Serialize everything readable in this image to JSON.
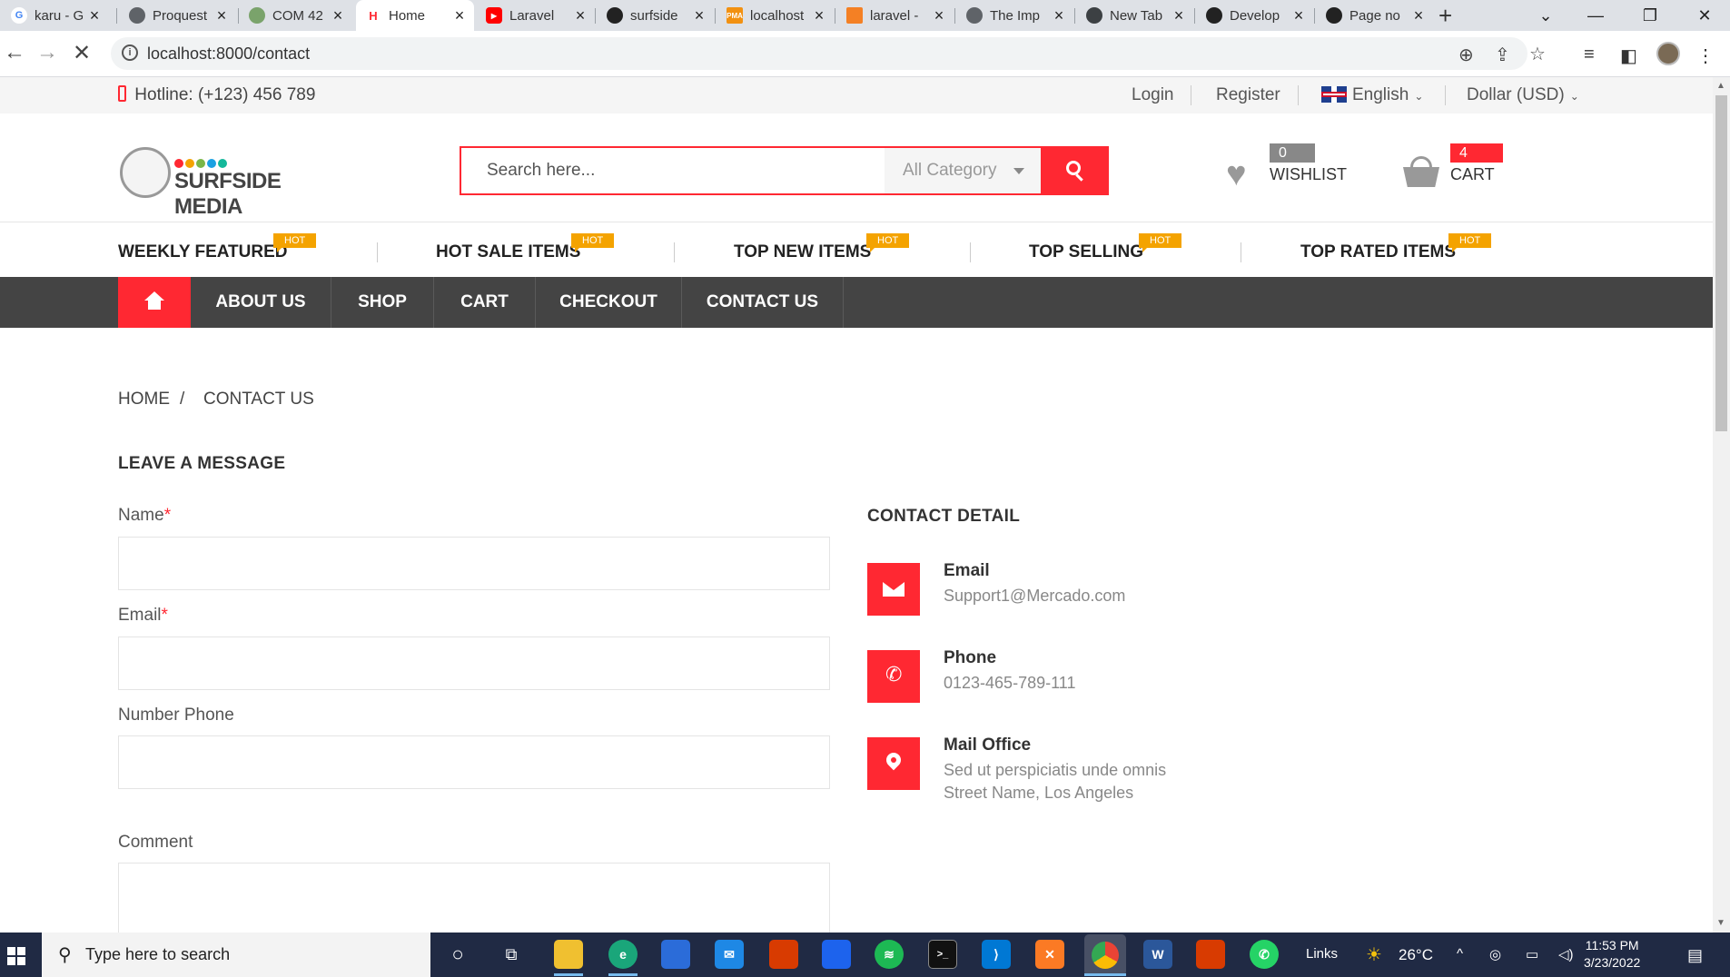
{
  "browser": {
    "tabs": [
      {
        "title": "karu - G",
        "icon": "google-icon"
      },
      {
        "title": "Proquest",
        "icon": "globe-icon"
      },
      {
        "title": "COM 42",
        "icon": "site-icon"
      },
      {
        "title": "Home",
        "icon": "surfside-favicon"
      },
      {
        "title": "Laravel",
        "icon": "youtube-icon"
      },
      {
        "title": "surfside",
        "icon": "github-icon"
      },
      {
        "title": "localhost",
        "icon": "phpmyadmin-icon"
      },
      {
        "title": "laravel -",
        "icon": "stackoverflow-icon"
      },
      {
        "title": "The Imp",
        "icon": "globe-icon"
      },
      {
        "title": "New Tab",
        "icon": "chrome-icon"
      },
      {
        "title": "Develop",
        "icon": "github-icon"
      },
      {
        "title": "Page no",
        "icon": "github-icon"
      }
    ],
    "url": "localhost:8000/contact"
  },
  "topbar": {
    "hotline": "Hotline: (+123) 456 789",
    "login": "Login",
    "register": "Register",
    "language": "English",
    "currency": "Dollar (USD)"
  },
  "header": {
    "logo_text": "SURFSIDE MEDIA",
    "search_placeholder": "Search here...",
    "category": "All Category",
    "wishlist_count": "0 item",
    "wishlist_label": "WISHLIST",
    "cart_count": "4 items",
    "cart_label": "CART"
  },
  "featured": {
    "items": [
      "WEEKLY FEATURED",
      "HOT SALE ITEMS",
      "TOP NEW ITEMS",
      "TOP SELLING",
      "TOP RATED ITEMS"
    ],
    "badge": "HOT"
  },
  "menu": {
    "items": [
      "ABOUT US",
      "SHOP",
      "CART",
      "CHECKOUT",
      "CONTACT US"
    ]
  },
  "breadcrumb": {
    "home": "HOME",
    "separator": "/",
    "current": "CONTACT US"
  },
  "form": {
    "heading": "LEAVE A MESSAGE",
    "name_label": "Name",
    "email_label": "Email",
    "required_mark": "*",
    "phone_label": "Number Phone",
    "comment_label": "Comment"
  },
  "contact": {
    "heading": "CONTACT DETAIL",
    "email_title": "Email",
    "email_value": "Support1@Mercado.com",
    "phone_title": "Phone",
    "phone_value": "0123-465-789-111",
    "office_title": "Mail Office",
    "office_line1": "Sed ut perspiciatis unde omnis",
    "office_line2": "Street Name, Los Angeles"
  },
  "taskbar": {
    "search_placeholder": "Type here to search",
    "links": "Links",
    "temperature": "26°C",
    "time": "11:53 PM",
    "date": "3/23/2022"
  },
  "colors": {
    "accent": "#ff2832",
    "menu_bg": "#444444",
    "hot_badge": "#f4a300"
  }
}
